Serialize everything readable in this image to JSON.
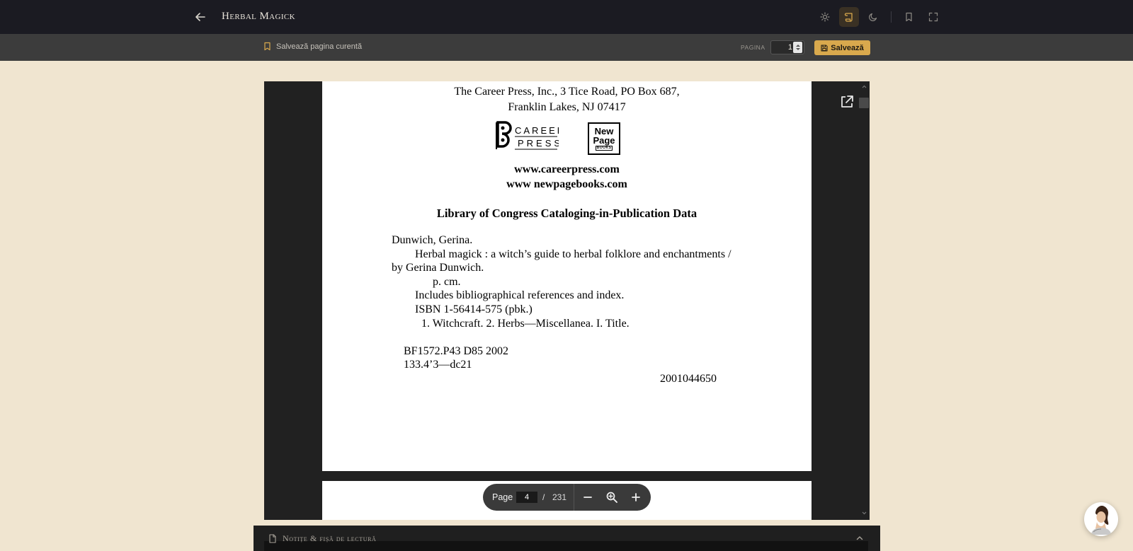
{
  "header": {
    "title": "Herbal Magick",
    "icons": [
      "back-arrow-icon",
      "sun-icon",
      "scroll-icon",
      "moon-icon",
      "bookmark-icon",
      "fullscreen-icon"
    ],
    "accent_color": "#d9a94d"
  },
  "subbar": {
    "save_current_label": "Salvează pagina curentă",
    "page_label": "PAGINA",
    "page_value": "1",
    "save_button_label": "Salvează"
  },
  "pdf": {
    "lines": {
      "publisher_line1": "The Career Press, Inc., 3 Tice Road, PO Box 687,",
      "publisher_line2": "Franklin Lakes, NJ 07417",
      "logo_career_line1": "CAREER",
      "logo_career_line2": "PRESS",
      "logo_newpage_line1": "New",
      "logo_newpage_line2": "Page",
      "logo_newpage_line3": "BOOKS",
      "url1": "www.careerpress.com",
      "url2": "www newpagebooks.com",
      "cip_heading": "Library of Congress Cataloging-in-Publication Data",
      "author": "Dunwich, Gerina.",
      "title_line1": "Herbal magick : a witch’s guide to herbal folklore and enchantments /",
      "title_line2": "by Gerina Dunwich.",
      "pcm": "p. cm.",
      "includes": "Includes bibliographical references and index.",
      "isbn": "ISBN 1-56414-575 (pbk.)",
      "subjects": "1.   Witchcraft. 2. Herbs—Miscellanea. I. Title.",
      "lcc": "BF1572.P43 D85 2002",
      "ddc": "133.4’3—dc21",
      "lccn": "2001044650"
    }
  },
  "viewer_toolbar": {
    "page_label": "Page",
    "page_value": "4",
    "separator": "/",
    "total_pages": "231"
  },
  "notes": {
    "title": "Notițe & fișă de lectură"
  }
}
